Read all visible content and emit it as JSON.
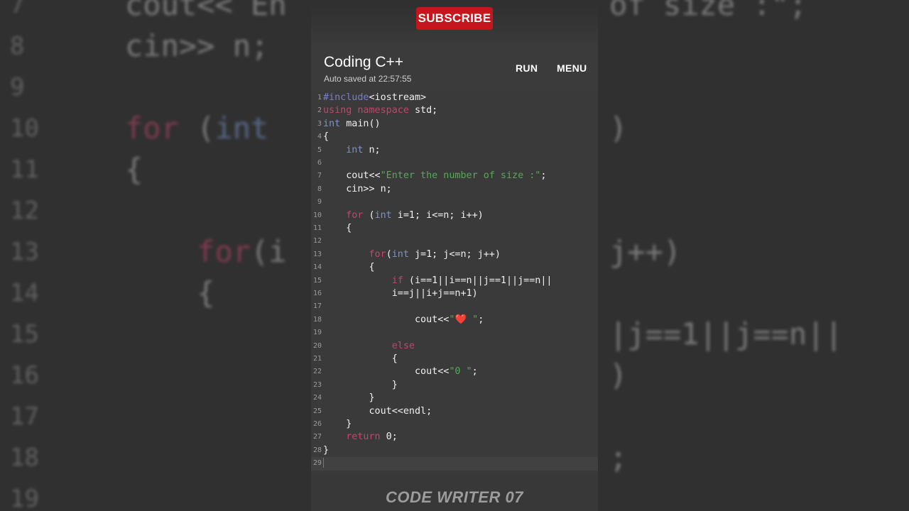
{
  "subscribe_label": "SUBSCRIBE",
  "app": {
    "title": "Coding C++",
    "autosave": "Auto saved at 22:57:55",
    "run_label": "RUN",
    "menu_label": "MENU"
  },
  "code_lines": [
    {
      "n": "1",
      "text": "#include<iostream>"
    },
    {
      "n": "2",
      "text": "using namespace std;"
    },
    {
      "n": "3",
      "text": "int main()"
    },
    {
      "n": "4",
      "text": "{"
    },
    {
      "n": "5",
      "text": "    int n;"
    },
    {
      "n": "6",
      "text": ""
    },
    {
      "n": "7",
      "text": "    cout<<\"Enter the number of size :\";"
    },
    {
      "n": "8",
      "text": "    cin>> n;"
    },
    {
      "n": "9",
      "text": ""
    },
    {
      "n": "10",
      "text": "    for (int i=1; i<=n; i++)"
    },
    {
      "n": "11",
      "text": "    {"
    },
    {
      "n": "12",
      "text": ""
    },
    {
      "n": "13",
      "text": "        for(int j=1; j<=n; j++)"
    },
    {
      "n": "14",
      "text": "        {"
    },
    {
      "n": "15",
      "text": "            if (i==1||i==n||j==1||j==n||"
    },
    {
      "n": "16",
      "text": "            i==j||i+j==n+1)"
    },
    {
      "n": "17",
      "text": ""
    },
    {
      "n": "18",
      "text": "                cout<<\"❤️ \";"
    },
    {
      "n": "19",
      "text": ""
    },
    {
      "n": "20",
      "text": "            else"
    },
    {
      "n": "21",
      "text": "            {"
    },
    {
      "n": "22",
      "text": "                cout<<\"0 \";"
    },
    {
      "n": "23",
      "text": "            }"
    },
    {
      "n": "24",
      "text": "        }"
    },
    {
      "n": "25",
      "text": "        cout<<endl;"
    },
    {
      "n": "26",
      "text": "    }"
    },
    {
      "n": "27",
      "text": "    return 0;"
    },
    {
      "n": "28",
      "text": "}"
    },
    {
      "n": "29",
      "text": ""
    }
  ],
  "watermark": "CODE WRITER 07",
  "background_lines": [
    {
      "n": "7",
      "left": "cout<< En",
      "right": "of size :\";"
    },
    {
      "n": "8",
      "left": "cin>> n;",
      "right": ""
    },
    {
      "n": "9",
      "left": "",
      "right": ""
    },
    {
      "n": "10",
      "left": "for (int",
      "right": ")"
    },
    {
      "n": "11",
      "left": "{",
      "right": ""
    },
    {
      "n": "12",
      "left": "",
      "right": ""
    },
    {
      "n": "13",
      "left": "    for(i",
      "right": "j++)"
    },
    {
      "n": "14",
      "left": "    {",
      "right": ""
    },
    {
      "n": "15",
      "left": "",
      "right": "|j==1||j==n||"
    },
    {
      "n": "16",
      "left": "",
      "right": ")"
    },
    {
      "n": "17",
      "left": "",
      "right": ""
    },
    {
      "n": "18",
      "left": "",
      "right": ";"
    },
    {
      "n": "19",
      "left": "",
      "right": ""
    }
  ],
  "colors": {
    "subscribe": "#c4161c",
    "keyword": "#c2456a",
    "type": "#7b93c9",
    "string": "#5aa65a",
    "preprocessor": "#7b7bd6",
    "editor_bg": "#3a3a3a"
  }
}
